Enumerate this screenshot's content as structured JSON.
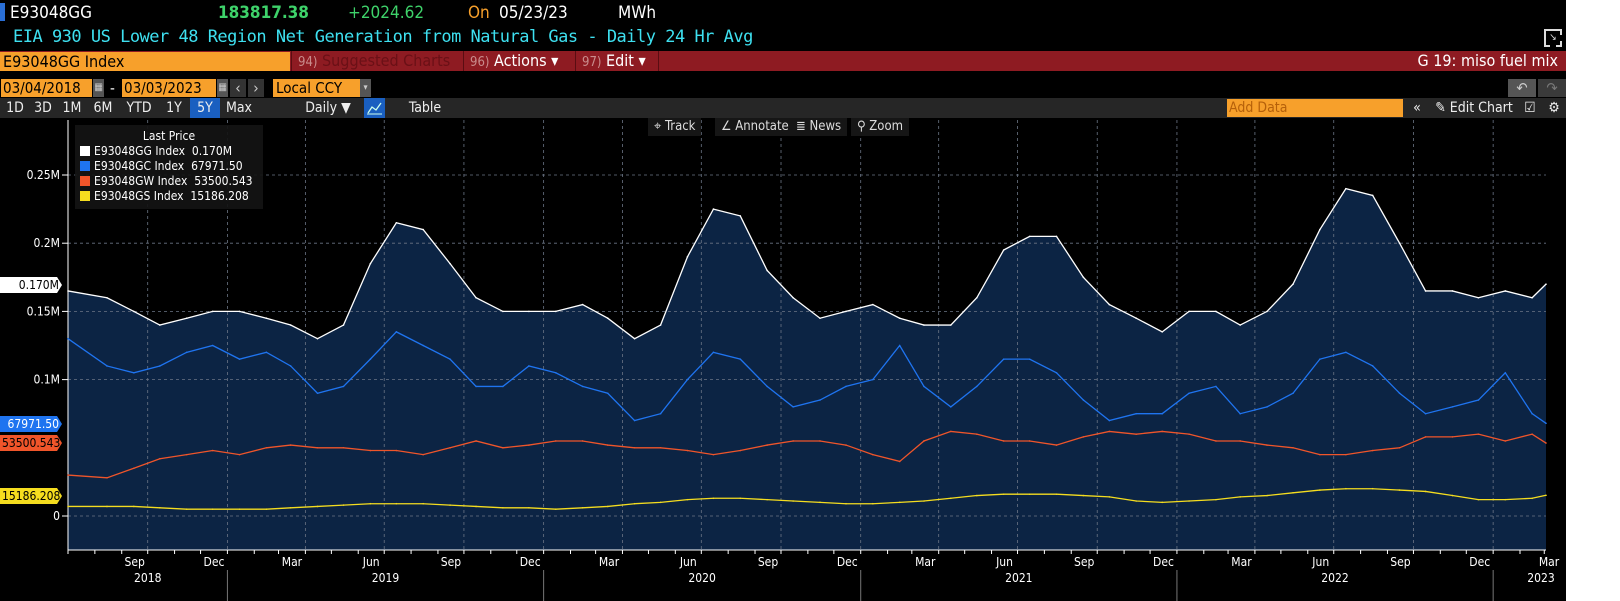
{
  "header": {
    "ticker": "E93048GG",
    "last_value": "183817.38",
    "change": "+2024.62",
    "on_label": "On",
    "date": "05/23/23",
    "unit": "MWh",
    "description": "EIA 930 US Lower 48 Region Net Generation from Natural Gas - Daily 24 Hr Avg"
  },
  "command_bar": {
    "security": "E93048GG Index",
    "suggested_num": "94)",
    "suggested": "Suggested Charts",
    "actions_num": "96)",
    "actions": "Actions ▾",
    "edit_num": "97)",
    "edit": "Edit ▾",
    "page_title": "G 19: miso fuel mix"
  },
  "date_range": {
    "start": "03/04/2018",
    "sep": "-",
    "end": "03/03/2023",
    "currency": "Local CCY"
  },
  "toolbar": {
    "periods": [
      "1D",
      "3D",
      "1M",
      "6M",
      "YTD",
      "1Y",
      "5Y",
      "Max"
    ],
    "selected_period": "5Y",
    "frequency": "Daily ▼",
    "table": "Table",
    "add_data_placeholder": "Add Data",
    "edit_chart": "Edit Chart"
  },
  "chart_tools": {
    "track": "Track",
    "annotate": "Annotate",
    "news": "News",
    "zoom": "Zoom"
  },
  "colors": {
    "GG": "#ffffff",
    "GC": "#1f74f0",
    "GW": "#f0552a",
    "GS": "#f5dd1f",
    "area": "#0c2444",
    "accent": "#f7a02b",
    "bar": "#8e1b22"
  },
  "chart_data": {
    "type": "line",
    "legend_title": "Last Price",
    "legend_placement": "top-left",
    "grid": true,
    "ylim": [
      0,
      250000
    ],
    "yticks": [
      {
        "v": 0,
        "label": "0"
      },
      {
        "v": 100000,
        "label": "0.1M"
      },
      {
        "v": 150000,
        "label": "0.15M"
      },
      {
        "v": 200000,
        "label": "0.2M"
      },
      {
        "v": 250000,
        "label": "0.25M"
      }
    ],
    "xrange": [
      "2018-07-01",
      "2023-03-03"
    ],
    "xticks_months": [
      {
        "m": "2018-09",
        "label": "Sep"
      },
      {
        "m": "2018-12",
        "label": "Dec"
      },
      {
        "m": "2019-03",
        "label": "Mar"
      },
      {
        "m": "2019-06",
        "label": "Jun"
      },
      {
        "m": "2019-09",
        "label": "Sep"
      },
      {
        "m": "2019-12",
        "label": "Dec"
      },
      {
        "m": "2020-03",
        "label": "Mar"
      },
      {
        "m": "2020-06",
        "label": "Jun"
      },
      {
        "m": "2020-09",
        "label": "Sep"
      },
      {
        "m": "2020-12",
        "label": "Dec"
      },
      {
        "m": "2021-03",
        "label": "Mar"
      },
      {
        "m": "2021-06",
        "label": "Jun"
      },
      {
        "m": "2021-09",
        "label": "Sep"
      },
      {
        "m": "2021-12",
        "label": "Dec"
      },
      {
        "m": "2022-03",
        "label": "Mar"
      },
      {
        "m": "2022-06",
        "label": "Jun"
      },
      {
        "m": "2022-09",
        "label": "Sep"
      },
      {
        "m": "2022-12",
        "label": "Dec"
      },
      {
        "m": "2023-02",
        "label": "Mar"
      }
    ],
    "xticks_years": [
      "2018",
      "2019",
      "2020",
      "2021",
      "2022",
      "2023"
    ],
    "x": [
      "2018-07",
      "2018-08",
      "2018-09",
      "2018-10",
      "2018-11",
      "2018-12",
      "2019-01",
      "2019-02",
      "2019-03",
      "2019-04",
      "2019-05",
      "2019-06",
      "2019-07",
      "2019-08",
      "2019-09",
      "2019-10",
      "2019-11",
      "2019-12",
      "2020-01",
      "2020-02",
      "2020-03",
      "2020-04",
      "2020-05",
      "2020-06",
      "2020-07",
      "2020-08",
      "2020-09",
      "2020-10",
      "2020-11",
      "2020-12",
      "2021-01",
      "2021-02",
      "2021-03",
      "2021-04",
      "2021-05",
      "2021-06",
      "2021-07",
      "2021-08",
      "2021-09",
      "2021-10",
      "2021-11",
      "2021-12",
      "2022-01",
      "2022-02",
      "2022-03",
      "2022-04",
      "2022-05",
      "2022-06",
      "2022-07",
      "2022-08",
      "2022-09",
      "2022-10",
      "2022-11",
      "2022-12",
      "2023-01",
      "2023-02",
      "2023-03"
    ],
    "series": [
      {
        "name": "E93048GG Index",
        "last": "0.170M",
        "key": "GG",
        "values": [
          165000,
          160000,
          150000,
          140000,
          145000,
          150000,
          150000,
          145000,
          140000,
          130000,
          140000,
          185000,
          215000,
          210000,
          185000,
          160000,
          150000,
          150000,
          150000,
          155000,
          145000,
          130000,
          140000,
          190000,
          225000,
          220000,
          180000,
          160000,
          145000,
          150000,
          155000,
          145000,
          140000,
          140000,
          160000,
          195000,
          205000,
          205000,
          175000,
          155000,
          145000,
          135000,
          150000,
          150000,
          140000,
          150000,
          170000,
          210000,
          240000,
          235000,
          200000,
          165000,
          165000,
          160000,
          165000,
          160000,
          170000
        ]
      },
      {
        "name": "E93048GC Index",
        "last": "67971.50",
        "key": "GC",
        "values": [
          130000,
          110000,
          105000,
          110000,
          120000,
          125000,
          115000,
          120000,
          110000,
          90000,
          95000,
          115000,
          135000,
          125000,
          115000,
          95000,
          95000,
          110000,
          105000,
          95000,
          90000,
          70000,
          75000,
          100000,
          120000,
          115000,
          95000,
          80000,
          85000,
          95000,
          100000,
          125000,
          95000,
          80000,
          95000,
          115000,
          115000,
          105000,
          85000,
          70000,
          75000,
          75000,
          90000,
          95000,
          75000,
          80000,
          90000,
          115000,
          120000,
          110000,
          90000,
          75000,
          80000,
          85000,
          105000,
          75000,
          67971.5
        ]
      },
      {
        "name": "E93048GW Index",
        "last": "53500.543",
        "key": "GW",
        "values": [
          30000,
          28000,
          35000,
          42000,
          45000,
          48000,
          45000,
          50000,
          52000,
          50000,
          50000,
          48000,
          48000,
          45000,
          50000,
          55000,
          50000,
          52000,
          55000,
          55000,
          52000,
          50000,
          50000,
          48000,
          45000,
          48000,
          52000,
          55000,
          55000,
          52000,
          45000,
          40000,
          55000,
          62000,
          60000,
          55000,
          55000,
          52000,
          58000,
          62000,
          60000,
          62000,
          60000,
          55000,
          55000,
          52000,
          50000,
          45000,
          45000,
          48000,
          50000,
          58000,
          58000,
          60000,
          55000,
          60000,
          53500.543
        ]
      },
      {
        "name": "E93048GS Index",
        "last": "15186.208",
        "key": "GS",
        "values": [
          7000,
          7000,
          7000,
          6000,
          5000,
          5000,
          5000,
          5000,
          6000,
          7000,
          8000,
          9000,
          9000,
          9000,
          8000,
          7000,
          6000,
          6000,
          5000,
          6000,
          7000,
          9000,
          10000,
          12000,
          13000,
          13000,
          12000,
          11000,
          10000,
          9000,
          9000,
          10000,
          11000,
          13000,
          15000,
          16000,
          16000,
          16000,
          15000,
          14000,
          11000,
          10000,
          11000,
          12000,
          14000,
          15000,
          17000,
          19000,
          20000,
          20000,
          19000,
          18000,
          15000,
          12000,
          12000,
          13000,
          15186.208
        ]
      }
    ]
  }
}
